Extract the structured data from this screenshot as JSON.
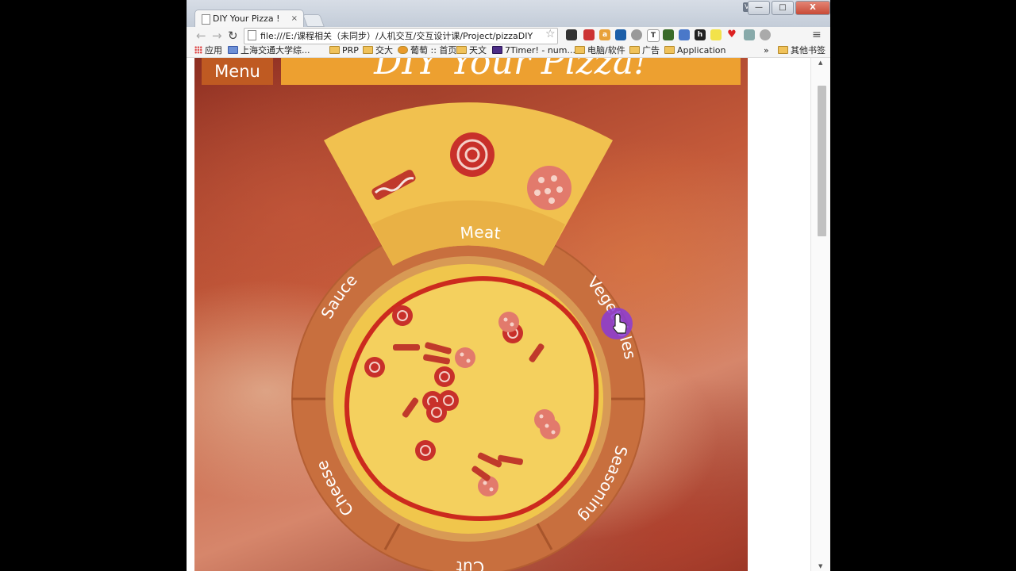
{
  "browser": {
    "tab_title": "DIY Your Pizza !",
    "tab_close": "×",
    "user_badge": "Vega",
    "window_buttons": [
      "—",
      "□",
      "X"
    ],
    "url": "file:///E:/课程相关（未同步）/人机交互/交互设计课/Project/pizzaDIY",
    "bookmarks": [
      {
        "label": "应用",
        "icon": "apps-grid-icon"
      },
      {
        "label": "上海交通大学综...",
        "icon": "page-icon"
      },
      {
        "label": "PRP",
        "icon": "folder-icon"
      },
      {
        "label": "交大",
        "icon": "folder-icon"
      },
      {
        "label": "葡萄 :: 首页",
        "icon": "grape-icon"
      },
      {
        "label": "天文",
        "icon": "folder-icon"
      },
      {
        "label": "7Timer! - num...",
        "icon": "yahoo-icon"
      },
      {
        "label": "电脑/软件",
        "icon": "folder-icon"
      },
      {
        "label": "广告",
        "icon": "folder-icon"
      },
      {
        "label": "Application",
        "icon": "folder-icon"
      }
    ],
    "more_bookmarks": "»",
    "other_bookmarks": "其他书签"
  },
  "app": {
    "menu_label": "Menu",
    "title": "DIY Your Pizza!",
    "wheel_sections": [
      "Meat",
      "Vegetables",
      "Seasoning",
      "Cut",
      "Cheese",
      "Sauce"
    ],
    "active_section": "Meat"
  },
  "colors": {
    "menu": "#bf5a22",
    "title_bar": "#eda030",
    "wheel": "#c86f3e",
    "meat_panel": "#f1c14f",
    "crust": "#f0c64c",
    "sauce_ring": "#cc2a1e",
    "cursor_highlight": "#8a3bd6"
  }
}
